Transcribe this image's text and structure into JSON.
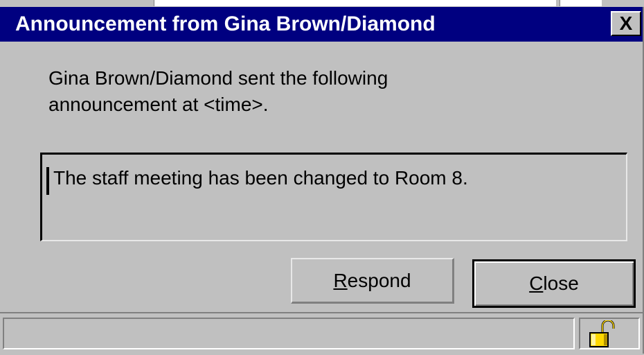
{
  "window": {
    "title": "Announcement from Gina Brown/Diamond",
    "close_glyph": "X"
  },
  "message": {
    "line1": "Gina Brown/Diamond sent the following",
    "line2": "announcement  at <time>."
  },
  "announcement": {
    "text": "The staff meeting has been changed to Room 8."
  },
  "buttons": {
    "respond": {
      "mnemonic": "R",
      "rest": "espond"
    },
    "close": {
      "mnemonic": "C",
      "rest": "lose"
    }
  },
  "status": {
    "text": "",
    "icon": "unlocked-padlock-icon"
  },
  "colors": {
    "titlebar": "#000080",
    "face": "#c0c0c0",
    "lock": "#ffd800"
  }
}
